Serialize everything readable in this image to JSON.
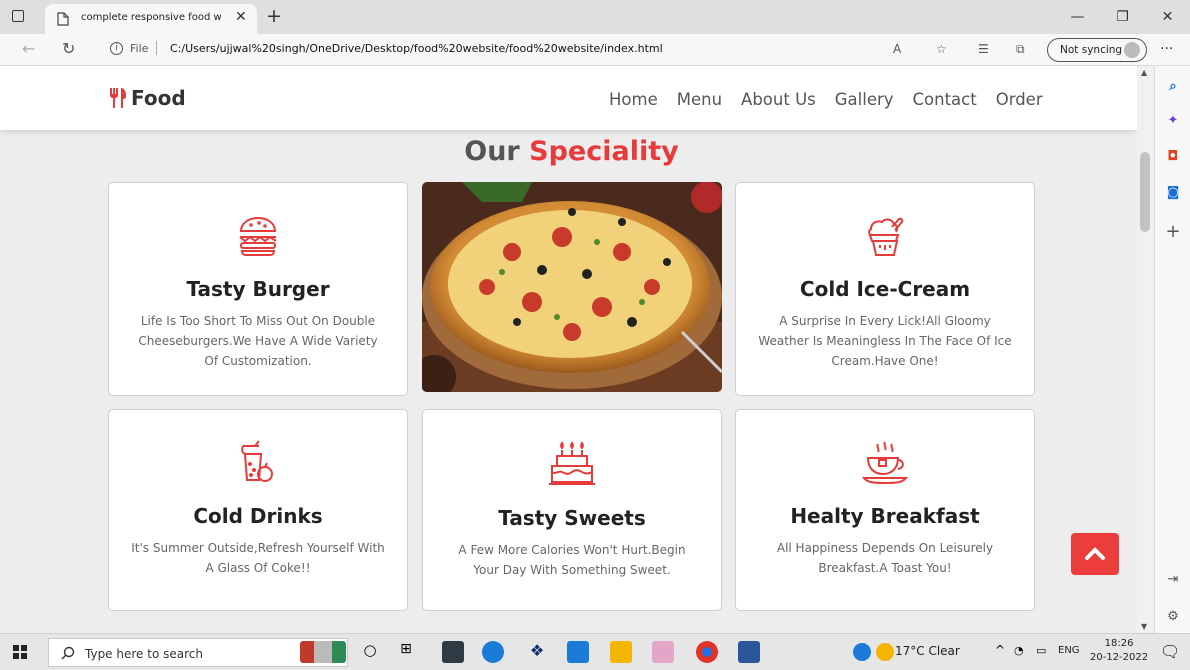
{
  "browser": {
    "tab_title": "complete responsive food websit",
    "url_scheme_label": "File",
    "url": "C:/Users/ujjwal%20singh/OneDrive/Desktop/food%20website/food%20website/index.html",
    "sync_label": "Not syncing"
  },
  "site": {
    "logo_text": "Food",
    "nav": [
      "Home",
      "Menu",
      "About Us",
      "Gallery",
      "Contact",
      "Order"
    ],
    "section_title_part1": "Our",
    "section_title_part2": "Speciality",
    "accent_color": "#e63b3b",
    "cards": [
      {
        "icon": "burger-icon",
        "title": "Tasty Burger",
        "desc": "Life Is Too Short To Miss Out On Double Cheeseburgers.We Have A Wide Variety Of Customization."
      },
      {
        "icon": "pizza-image",
        "title": "",
        "desc": ""
      },
      {
        "icon": "ice-cream-icon",
        "title": "Cold Ice-Cream",
        "desc": "A Surprise In Every Lick!All Gloomy Weather Is Meaningless In The Face Of Ice Cream.Have One!"
      },
      {
        "icon": "drink-icon",
        "title": "Cold Drinks",
        "desc": "It's Summer Outside,Refresh Yourself With A Glass Of Coke!!"
      },
      {
        "icon": "cake-icon",
        "title": "Tasty Sweets",
        "desc": "A Few More Calories Won't Hurt.Begin Your Day With Something Sweet."
      },
      {
        "icon": "coffee-cup-icon",
        "title": "Healty Breakfast",
        "desc": "All Happiness Depends On Leisurely Breakfast.A Toast You!"
      }
    ]
  },
  "taskbar": {
    "search_placeholder": "Type here to search",
    "weather": "17°C  Clear",
    "lang": "ENG",
    "time": "18:26",
    "date": "20-12-2022"
  }
}
